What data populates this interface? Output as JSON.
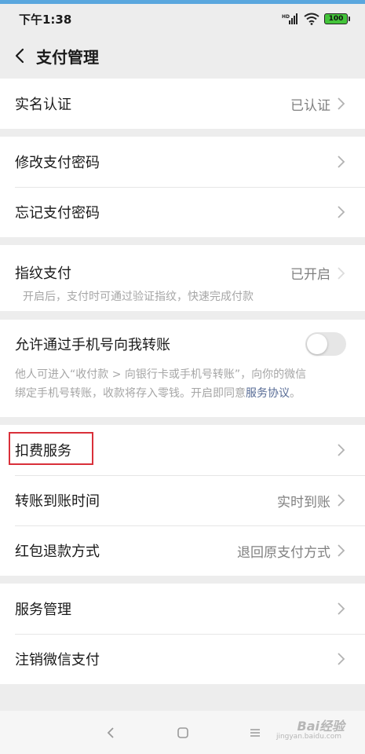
{
  "status_bar": {
    "time": "下午1:38",
    "signal_label": "HD",
    "battery": "100"
  },
  "header": {
    "title": "支付管理"
  },
  "sections": {
    "realname": {
      "label": "实名认证",
      "value": "已认证"
    },
    "modify_password": {
      "label": "修改支付密码"
    },
    "forgot_password": {
      "label": "忘记支付密码"
    },
    "fingerprint": {
      "label": "指纹支付",
      "value": "已开启",
      "description": "开启后，支付时可通过验证指纹，快速完成付款"
    },
    "phone_transfer": {
      "label": "允许通过手机号向我转账",
      "toggle_on": false,
      "description_line1": "他人可进入“收付款 > 向银行卡或手机号转账”，向你的微信",
      "description_line2_prefix": "绑定手机号转账，收款将存入零钱。开启即同意",
      "description_link": "服务协议",
      "description_suffix": "。"
    },
    "deduction": {
      "label": "扣费服务"
    },
    "transfer_time": {
      "label": "转账到账时间",
      "value": "实时到账"
    },
    "red_packet_refund": {
      "label": "红包退款方式",
      "value": "退回原支付方式"
    },
    "service_management": {
      "label": "服务管理"
    },
    "cancel_pay": {
      "label": "注销微信支付"
    }
  },
  "watermark": {
    "brand": "Bai经验",
    "url": "jingyan.baidu.com"
  },
  "colors": {
    "background": "#ededed",
    "highlight_border": "#d9303a",
    "link": "#576b95",
    "top_accent": "#5aa7de"
  }
}
